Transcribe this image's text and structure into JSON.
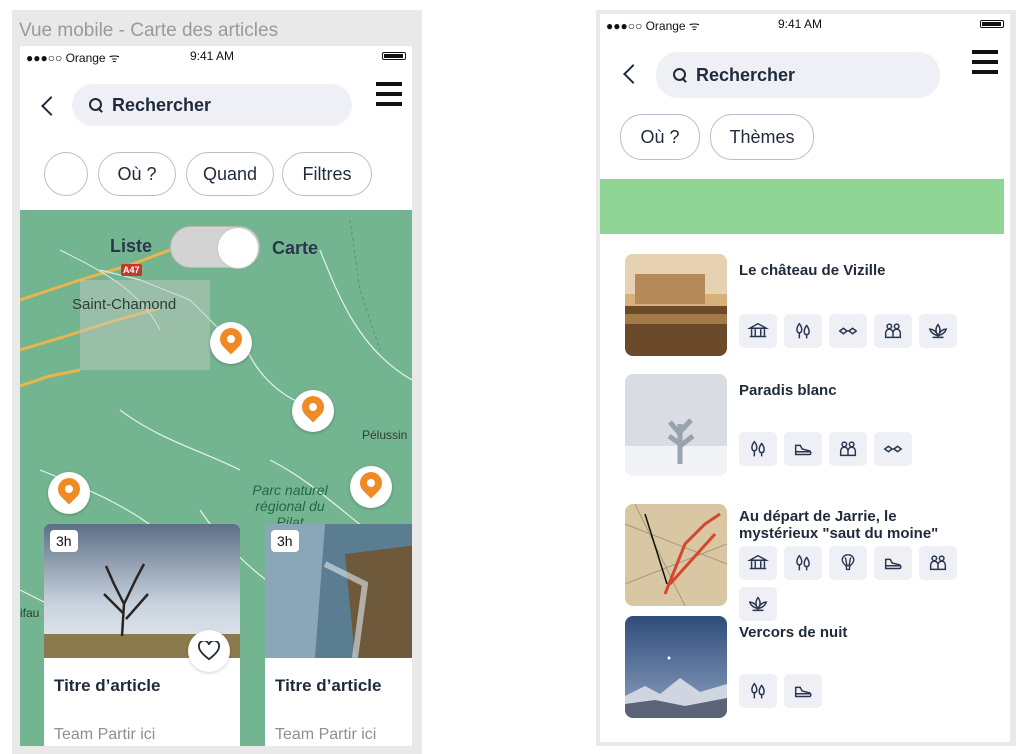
{
  "left_frame": {
    "title": "Vue mobile - Carte des articles",
    "status": {
      "carrier": "●●●○○ Orange ᯤ",
      "time": "9:41 AM"
    },
    "search_placeholder": "Rechercher",
    "chips": [
      "",
      "Où ?",
      "Quand",
      "Filtres"
    ],
    "toggle": {
      "left_label": "Liste",
      "right_label": "Carte",
      "selected": "Carte"
    },
    "map_labels": {
      "city1": "Saint-Chamond",
      "city2": "Pélussin",
      "park": "Parc naturel régional du Pilat",
      "road": "A47",
      "partial": "ifau"
    },
    "cards": [
      {
        "duration": "3h",
        "title": "Titre d’article",
        "author": "Team Partir ici"
      },
      {
        "duration": "3h",
        "title": "Titre d’article",
        "author": "Team Partir ici"
      }
    ],
    "colors": {
      "map": "#74b591",
      "pin": "#ef8a25"
    }
  },
  "right_frame": {
    "status": {
      "carrier": "●●●○○ Orange ᯤ",
      "time": "9:41 AM"
    },
    "search_placeholder": "Rechercher",
    "chips": [
      "Où ?",
      "Thèmes"
    ],
    "banner_color": "#8fd595",
    "articles": [
      {
        "title": "Le château de Vizille",
        "tags": [
          "museum-icon",
          "trees-icon",
          "glasses-icon",
          "family-icon",
          "lotus-icon"
        ]
      },
      {
        "title": "Paradis blanc",
        "tags": [
          "trees-icon",
          "shoe-icon",
          "family-icon",
          "glasses-icon"
        ]
      },
      {
        "title": "Au départ de Jarrie, le mystérieux \"saut du moine\"",
        "tags": [
          "museum-icon",
          "trees-icon",
          "balloon-icon",
          "shoe-icon",
          "family-icon",
          "lotus-icon"
        ]
      },
      {
        "title": "Vercors de nuit",
        "tags": [
          "trees-icon",
          "shoe-icon"
        ]
      }
    ]
  }
}
